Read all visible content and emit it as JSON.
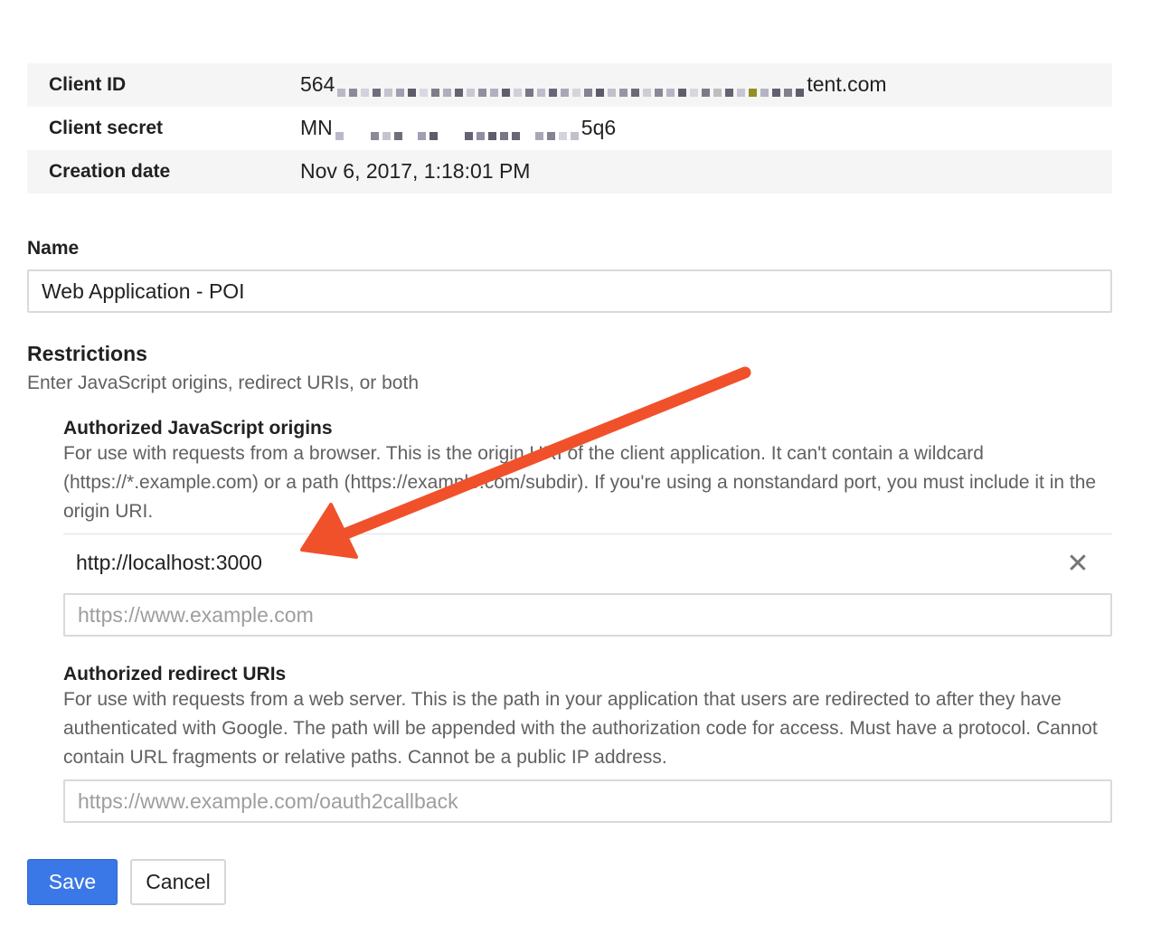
{
  "details": {
    "client_id_label": "Client ID",
    "client_id_prefix": "564",
    "client_id_suffix": "tent.com",
    "client_secret_label": "Client secret",
    "client_secret_prefix": "MN",
    "client_secret_suffix": "5q6",
    "creation_date_label": "Creation date",
    "creation_date_value": "Nov 6, 2017, 1:18:01 PM"
  },
  "name_section": {
    "label": "Name",
    "value": "Web Application - POI"
  },
  "restrictions": {
    "title": "Restrictions",
    "description": "Enter JavaScript origins, redirect URIs, or both",
    "js_origins": {
      "title": "Authorized JavaScript origins",
      "description": "For use with requests from a browser. This is the origin URI of the client application. It can't contain a wildcard (https://*.example.com) or a path (https://example.com/subdir). If you're using a nonstandard port, you must include it in the origin URI.",
      "entries": [
        "http://localhost:3000"
      ],
      "remove_icon": "close-icon",
      "remove_glyph": "✕",
      "placeholder": "https://www.example.com"
    },
    "redirect_uris": {
      "title": "Authorized redirect URIs",
      "description": "For use with requests from a web server. This is the path in your application that users are redirected to after they have authenticated with Google. The path will be appended with the authorization code for access. Must have a protocol. Cannot contain URL fragments or relative paths. Cannot be a public IP address.",
      "placeholder": "https://www.example.com/oauth2callback"
    }
  },
  "actions": {
    "save_label": "Save",
    "cancel_label": "Cancel"
  },
  "colors": {
    "primary_button": "#3b78e7",
    "annotation_arrow": "#f0512b",
    "table_background": "#f5f5f5"
  }
}
